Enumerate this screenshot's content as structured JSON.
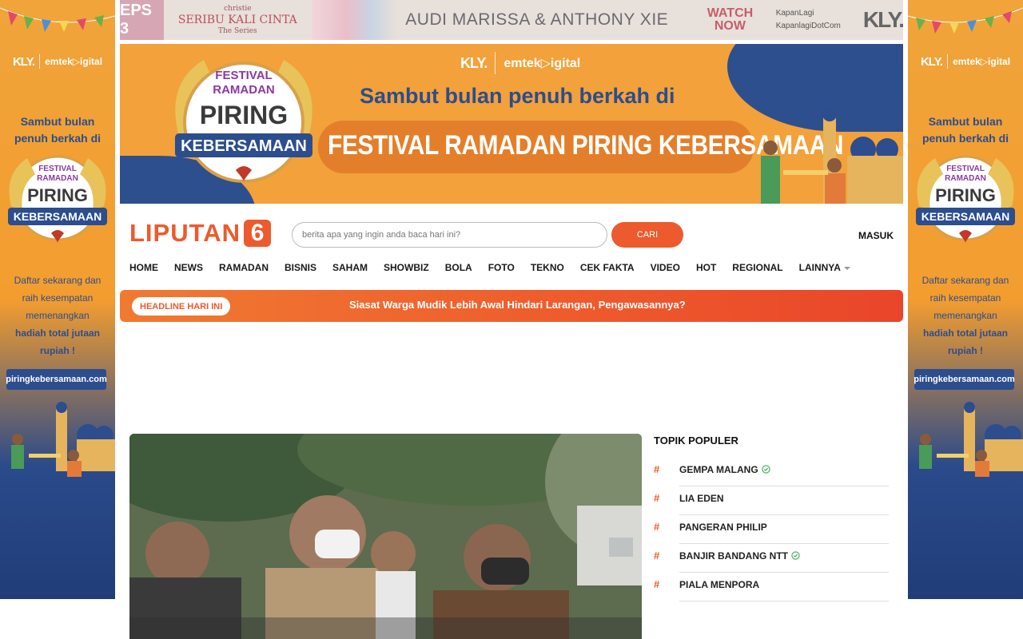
{
  "colors": {
    "brand": "#ec5a2d",
    "ad_orange": "#f3a13a",
    "ad_blue": "#2c4d8e",
    "headline_gradient_start": "#f07a32",
    "headline_gradient_end": "#e9452a"
  },
  "top_ad": {
    "episode": "EPS 3",
    "series_brand": "christie",
    "series_title": "SERIBU KALI CINTA",
    "series_sub": "The Series",
    "stars": "AUDI MARISSA & ANTHONY XIE",
    "cta": "WATCH NOW",
    "social_1": "KapanLagi",
    "social_2": "KapanlagiDotCom",
    "network": "KLY."
  },
  "banner_ad": {
    "brand_kly": "KLY.",
    "brand_emtek": "emtek▷igital",
    "badge_top": "FESTIVAL RAMADAN",
    "badge_main": "PIRING",
    "badge_ribbon": "KEBERSAMAAN",
    "lead": "Sambut bulan penuh berkah di",
    "title": "FESTIVAL RAMADAN PIRING KEBERSAMAAN"
  },
  "side_ad": {
    "brand_kly": "KLY.",
    "brand_emtek": "emtek▷igital",
    "tagline": "Sambut bulan penuh berkah di",
    "body_1": "Daftar sekarang dan raih kesempatan memenangkan",
    "body_bold": "hadiah total jutaan rupiah !",
    "url": "piringkebersamaan.com"
  },
  "header": {
    "logo_word": "LIPUTAN",
    "logo_six": "6",
    "search_placeholder": "berita apa yang ingin anda baca hari ini?",
    "search_button": "CARI",
    "login": "MASUK"
  },
  "nav": {
    "items": [
      "HOME",
      "NEWS",
      "RAMADAN",
      "BISNIS",
      "SAHAM",
      "SHOWBIZ",
      "BOLA",
      "FOTO",
      "TEKNO",
      "CEK FAKTA",
      "VIDEO",
      "HOT",
      "REGIONAL"
    ],
    "more": "LAINNYA"
  },
  "headline": {
    "label": "HEADLINE HARI INI",
    "text": "Siasat Warga Mudik Lebih Awal Hindari Larangan, Pengawasannya?"
  },
  "topics": {
    "heading": "TOPIK POPULER",
    "items": [
      {
        "hash": "#",
        "label": "GEMPA MALANG",
        "verified": true
      },
      {
        "hash": "#",
        "label": "LIA EDEN",
        "verified": false
      },
      {
        "hash": "#",
        "label": "PANGERAN PHILIP",
        "verified": false
      },
      {
        "hash": "#",
        "label": "BANJIR BANDANG NTT",
        "verified": true
      },
      {
        "hash": "#",
        "label": "PIALA MENPORA",
        "verified": false
      }
    ]
  }
}
